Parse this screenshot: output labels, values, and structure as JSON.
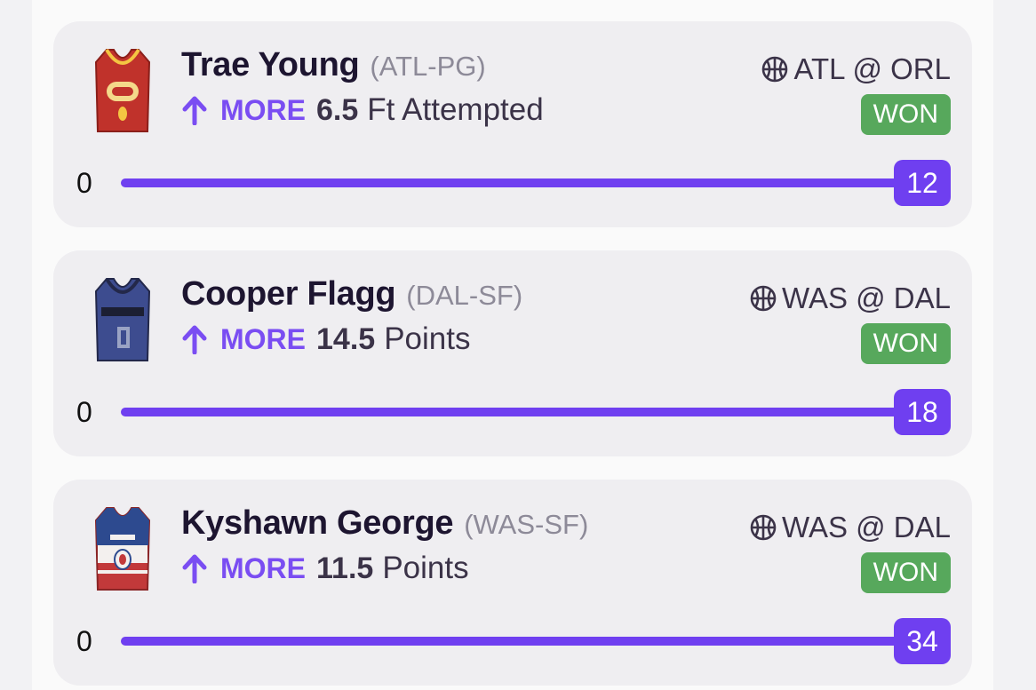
{
  "accent_color": "#6f3ff0",
  "won_color": "#57a85c",
  "picks": [
    {
      "player_name": "Trae Young",
      "player_team": "(ATL-PG)",
      "direction": "MORE",
      "line_value": "6.5",
      "stat": "Ft Attempted",
      "matchup": "ATL @ ORL",
      "result": "WON",
      "min_label": "0",
      "actual_value": "12",
      "progress": 1.0,
      "jersey_icon": "atlanta-jersey-icon",
      "jersey_colors": {
        "body": "#c0322b",
        "trim": "#f4c542",
        "number": "0"
      }
    },
    {
      "player_name": "Cooper Flagg",
      "player_team": "(DAL-SF)",
      "direction": "MORE",
      "line_value": "14.5",
      "stat": "Points",
      "matchup": "WAS @ DAL",
      "result": "WON",
      "min_label": "0",
      "actual_value": "18",
      "progress": 1.0,
      "jersey_icon": "dallas-jersey-icon",
      "jersey_colors": {
        "body": "#3d4c8f",
        "trim": "#23284a",
        "number": "0"
      }
    },
    {
      "player_name": "Kyshawn George",
      "player_team": "(WAS-SF)",
      "direction": "MORE",
      "line_value": "11.5",
      "stat": "Points",
      "matchup": "WAS @ DAL",
      "result": "WON",
      "min_label": "0",
      "actual_value": "34",
      "progress": 1.0,
      "jersey_icon": "washington-jersey-icon",
      "jersey_colors": {
        "body": "#c2393a",
        "trim": "#2d4a8f",
        "number": "0"
      }
    }
  ]
}
